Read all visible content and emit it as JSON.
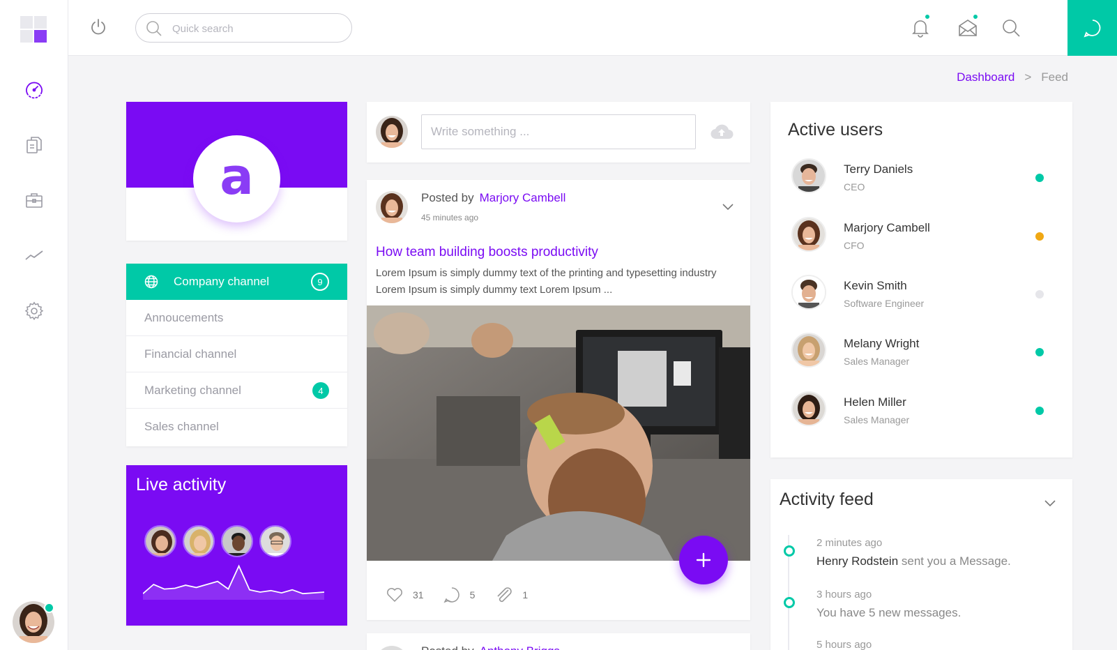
{
  "colors": {
    "accent": "#7a0bf3",
    "teal": "#00c9a7",
    "online": "#00c9a7",
    "away": "#f0a814",
    "offline": "#e6e6ea"
  },
  "sidebar": {
    "nav": [
      {
        "icon": "speedometer-icon",
        "active": true
      },
      {
        "icon": "documents-icon"
      },
      {
        "icon": "briefcase-icon"
      },
      {
        "icon": "trending-chart-icon"
      },
      {
        "icon": "gear-icon"
      }
    ]
  },
  "topbar": {
    "search_placeholder": "Quick search"
  },
  "breadcrumb": {
    "root": "Dashboard",
    "separator": ">",
    "current": "Feed"
  },
  "profile": {
    "letter": "a"
  },
  "channels": [
    {
      "label": "Company channel",
      "badge": "9",
      "active": true
    },
    {
      "label": "Annoucements"
    },
    {
      "label": "Financial channel"
    },
    {
      "label": "Marketing channel",
      "badge": "4"
    },
    {
      "label": "Sales channel"
    }
  ],
  "live_activity": {
    "title": "Live activity",
    "sparkline": [
      8,
      20,
      14,
      15,
      19,
      16,
      20,
      24,
      14,
      44,
      13,
      10,
      12,
      9,
      13,
      8,
      9,
      10
    ]
  },
  "composer": {
    "placeholder": "Write something ..."
  },
  "post": {
    "posted_by_label": "Posted by",
    "author": "Marjory Cambell",
    "time": "45 minutes ago",
    "title": "How team building boosts productivity",
    "excerpt": "Lorem Ipsum is simply dummy text of the printing and typesetting industry Lorem Ipsum is simply dummy text Lorem Ipsum ...",
    "likes": "31",
    "comments": "5",
    "attachments": "1"
  },
  "post2": {
    "posted_by_label": "Posted by",
    "author": "Anthony Briggs"
  },
  "active_users": {
    "title": "Active users",
    "users": [
      {
        "name": "Terry Daniels",
        "role": "CEO",
        "status": "online"
      },
      {
        "name": "Marjory Cambell",
        "role": "CFO",
        "status": "away"
      },
      {
        "name": "Kevin Smith",
        "role": "Software Engineer",
        "status": "offline"
      },
      {
        "name": "Melany Wright",
        "role": "Sales Manager",
        "status": "online"
      },
      {
        "name": "Helen Miller",
        "role": "Sales Manager",
        "status": "online"
      }
    ]
  },
  "activity_feed": {
    "title": "Activity feed",
    "items": [
      {
        "time": "2 minutes ago",
        "actor": "Henry Rodstein",
        "text": " sent you a Message."
      },
      {
        "time": "3 hours ago",
        "actor": "",
        "text": "You have 5 new messages."
      },
      {
        "time": "5 hours ago",
        "actor": "",
        "text": ""
      }
    ]
  }
}
